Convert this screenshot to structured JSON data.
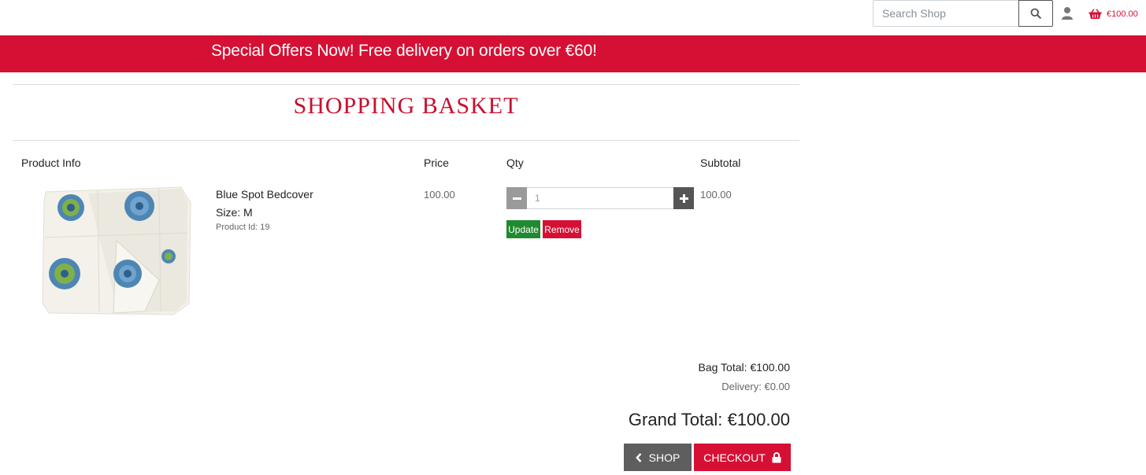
{
  "header": {
    "search_placeholder": "Search Shop",
    "search_icon": "search-icon",
    "account_icon": "user-icon",
    "basket_icon": "basket-icon",
    "basket_total": "€100.00"
  },
  "banner": {
    "text": "Special Offers Now! Free delivery on orders over €60!"
  },
  "page": {
    "title": "SHOPPING BASKET"
  },
  "table": {
    "headers": {
      "product_info": "Product Info",
      "price": "Price",
      "qty": "Qty",
      "subtotal": "Subtotal"
    },
    "rows": [
      {
        "image": "blue-spot-bedcover-image",
        "name": "Blue Spot Bedcover",
        "size": "Size: M",
        "product_id": "Product Id: 19",
        "price": "100.00",
        "qty": "1",
        "subtotal": "100.00",
        "update_label": "Update",
        "remove_label": "Remove"
      }
    ]
  },
  "totals": {
    "bag_total": "Bag Total: €100.00",
    "delivery": "Delivery: €0.00",
    "grand_total": "Grand Total: €100.00"
  },
  "actions": {
    "shop_label": "SHOP",
    "checkout_label": "CHECKOUT"
  },
  "colors": {
    "brand_red": "#d51034",
    "update_green": "#1f8a2f",
    "shop_grey": "#5e5e5e"
  }
}
